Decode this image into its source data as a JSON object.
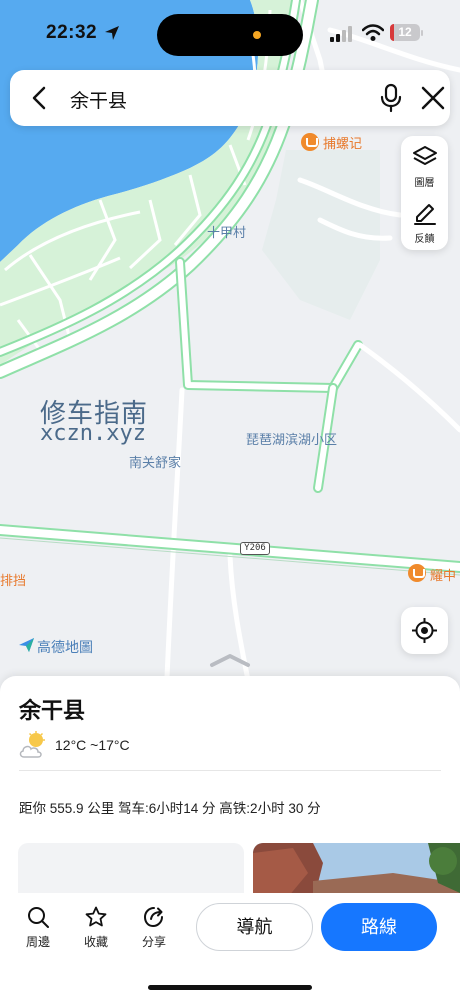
{
  "status_bar": {
    "time": "22:32",
    "battery_level": "12",
    "battery_fraction": 0.12
  },
  "search": {
    "query": "余干县"
  },
  "map_tools": {
    "layers_label": "圖層",
    "feedback_label": "反饋"
  },
  "map": {
    "labels": {
      "poi_bulouji": "捕螺记",
      "village_shijia": "十甲村",
      "community_pipa": "琵琶湖滨湖小区",
      "community_nanguan": "南关舒家",
      "road_code": "Y206",
      "poi_paidang": "排挡",
      "poi_yaozhong": "耀中"
    },
    "watermark": {
      "line1": "修车指南",
      "line2": "xczn.xyz"
    },
    "provider": "高德地圖",
    "colors": {
      "water": "#56aaf0",
      "green": "#d6f2d8",
      "road_edge": "#8fe0a8",
      "land": "#eef0f3"
    }
  },
  "place": {
    "name": "余干县",
    "weather": "12°C ~17°C",
    "distance": "距你 555.9 公里 驾车:6小时14 分 高铁:2小时 30 分"
  },
  "actions": {
    "nearby": "周邊",
    "favorite": "收藏",
    "share": "分享",
    "navigate": "導航",
    "route": "路線"
  },
  "accent_color": "#1677ff"
}
